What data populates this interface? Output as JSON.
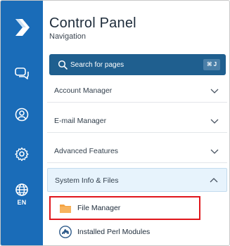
{
  "app": {
    "title": "Control Panel",
    "subtitle": "Navigation"
  },
  "rail": {
    "icons": [
      "brand-logo-icon",
      "chat-icon",
      "user-icon",
      "gear-icon",
      "globe-icon"
    ],
    "language": "EN"
  },
  "search": {
    "placeholder": "Search for pages",
    "shortcut": "⌘ J"
  },
  "menu": {
    "items": [
      {
        "label": "Account Manager",
        "expanded": false
      },
      {
        "label": "E-mail Manager",
        "expanded": false
      },
      {
        "label": "Advanced Features",
        "expanded": false
      },
      {
        "label": "System Info & Files",
        "expanded": true
      }
    ],
    "submenu": [
      {
        "label": "File Manager",
        "icon": "folder-icon",
        "highlighted": true
      },
      {
        "label": "Installed Perl Modules",
        "icon": "perl-camel-icon",
        "highlighted": false
      }
    ]
  },
  "colors": {
    "rail": "#1a6cb8",
    "search_bg": "#1f5f8f",
    "highlight": "#e0161c",
    "open_item_bg": "#e7f3fc"
  }
}
